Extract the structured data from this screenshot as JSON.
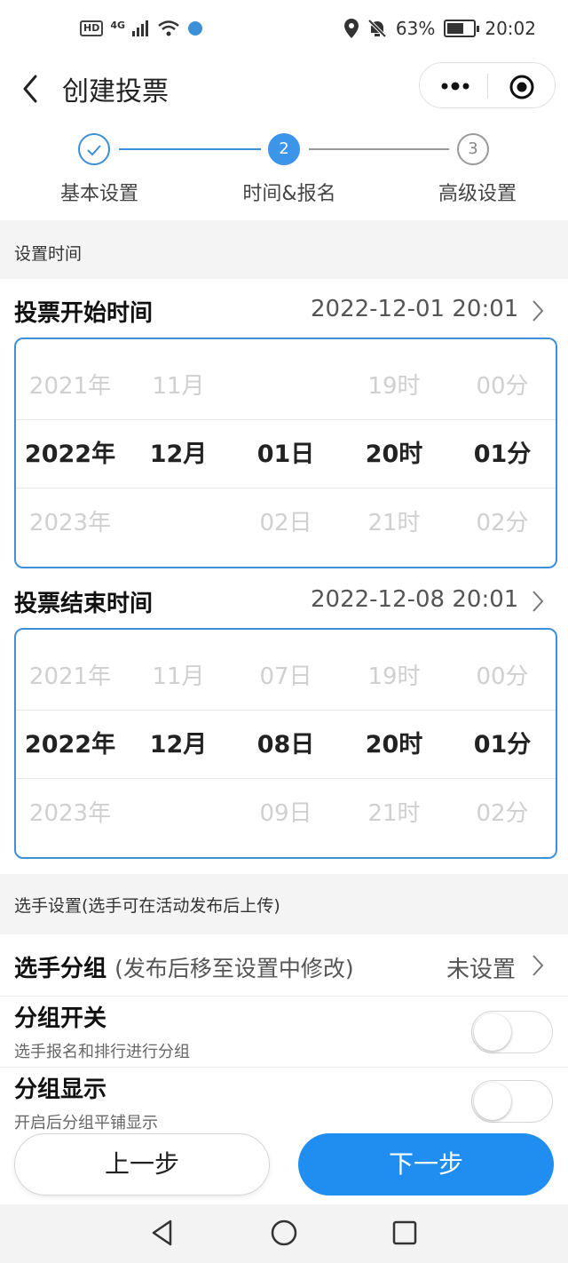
{
  "status_bar": {
    "hd": "HD",
    "network": "4G",
    "battery": "63%",
    "battery_level": 0.63,
    "time": "20:02"
  },
  "nav": {
    "title": "创建投票"
  },
  "steps": [
    {
      "number": "1",
      "label": "基本设置",
      "state": "done"
    },
    {
      "number": "2",
      "label": "时间&报名",
      "state": "active"
    },
    {
      "number": "3",
      "label": "高级设置",
      "state": "pending"
    }
  ],
  "colors": {
    "accent": "#1f8ef0",
    "picker_border": "#3d8fd8"
  },
  "time_section": {
    "header": "设置时间",
    "start": {
      "label": "投票开始时间",
      "value": "2022-12-01 20:01",
      "picker": {
        "above": [
          "2021年",
          "11月",
          "",
          "19时",
          "00分"
        ],
        "selected": [
          "2022年",
          "12月",
          "01日",
          "20时",
          "01分"
        ],
        "below": [
          "2023年",
          "",
          "02日",
          "21时",
          "02分"
        ]
      }
    },
    "end": {
      "label": "投票结束时间",
      "value": "2022-12-08 20:01",
      "picker": {
        "above": [
          "2021年",
          "11月",
          "07日",
          "19时",
          "00分"
        ],
        "selected": [
          "2022年",
          "12月",
          "08日",
          "20时",
          "01分"
        ],
        "below": [
          "2023年",
          "",
          "09日",
          "21时",
          "02分"
        ]
      }
    }
  },
  "player_section": {
    "header": "选手设置(选手可在活动发布后上传)",
    "group": {
      "label": "选手分组",
      "hint": "(发布后移至设置中修改)",
      "value": "未设置"
    },
    "group_switch": {
      "label": "分组开关",
      "sub": "选手报名和排行进行分组",
      "on": false
    },
    "group_display": {
      "label": "分组显示",
      "sub": "开启后分组平铺显示",
      "on": false
    }
  },
  "buttons": {
    "prev": "上一步",
    "next": "下一步"
  }
}
